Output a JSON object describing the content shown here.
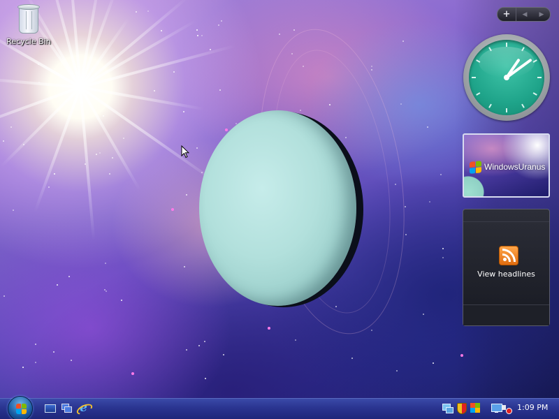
{
  "desktop": {
    "icons": [
      {
        "label": "Recycle Bin",
        "icon": "recycle-bin-icon"
      }
    ],
    "wallpaper": "space-planet-sunburst"
  },
  "sidebar": {
    "controls": {
      "add_label": "+",
      "prev_label": "◀",
      "next_label": "▶"
    },
    "gadgets": {
      "clock": {
        "hour": 1,
        "minute": 9
      },
      "slideshow": {
        "caption": "WindowsUranus"
      },
      "headlines": {
        "label": "View headlines",
        "icon": "rss-feed-icon"
      }
    }
  },
  "taskbar": {
    "start_icon": "windows-start-orb",
    "quick_launch": [
      {
        "name": "show-desktop",
        "icon": "show-desktop-icon"
      },
      {
        "name": "switch-windows",
        "icon": "switch-windows-icon"
      },
      {
        "name": "internet-explorer",
        "icon": "internet-explorer-icon"
      }
    ],
    "tray": {
      "icons": [
        "network-icon",
        "security-shield-icon",
        "windows-icon",
        "display-icon",
        "volume-muted-icon"
      ],
      "time": "1:09 PM"
    }
  },
  "colors": {
    "taskbar": "#2a3490",
    "clock_face": "#1fa48a",
    "planet": "#b2e0dc"
  }
}
